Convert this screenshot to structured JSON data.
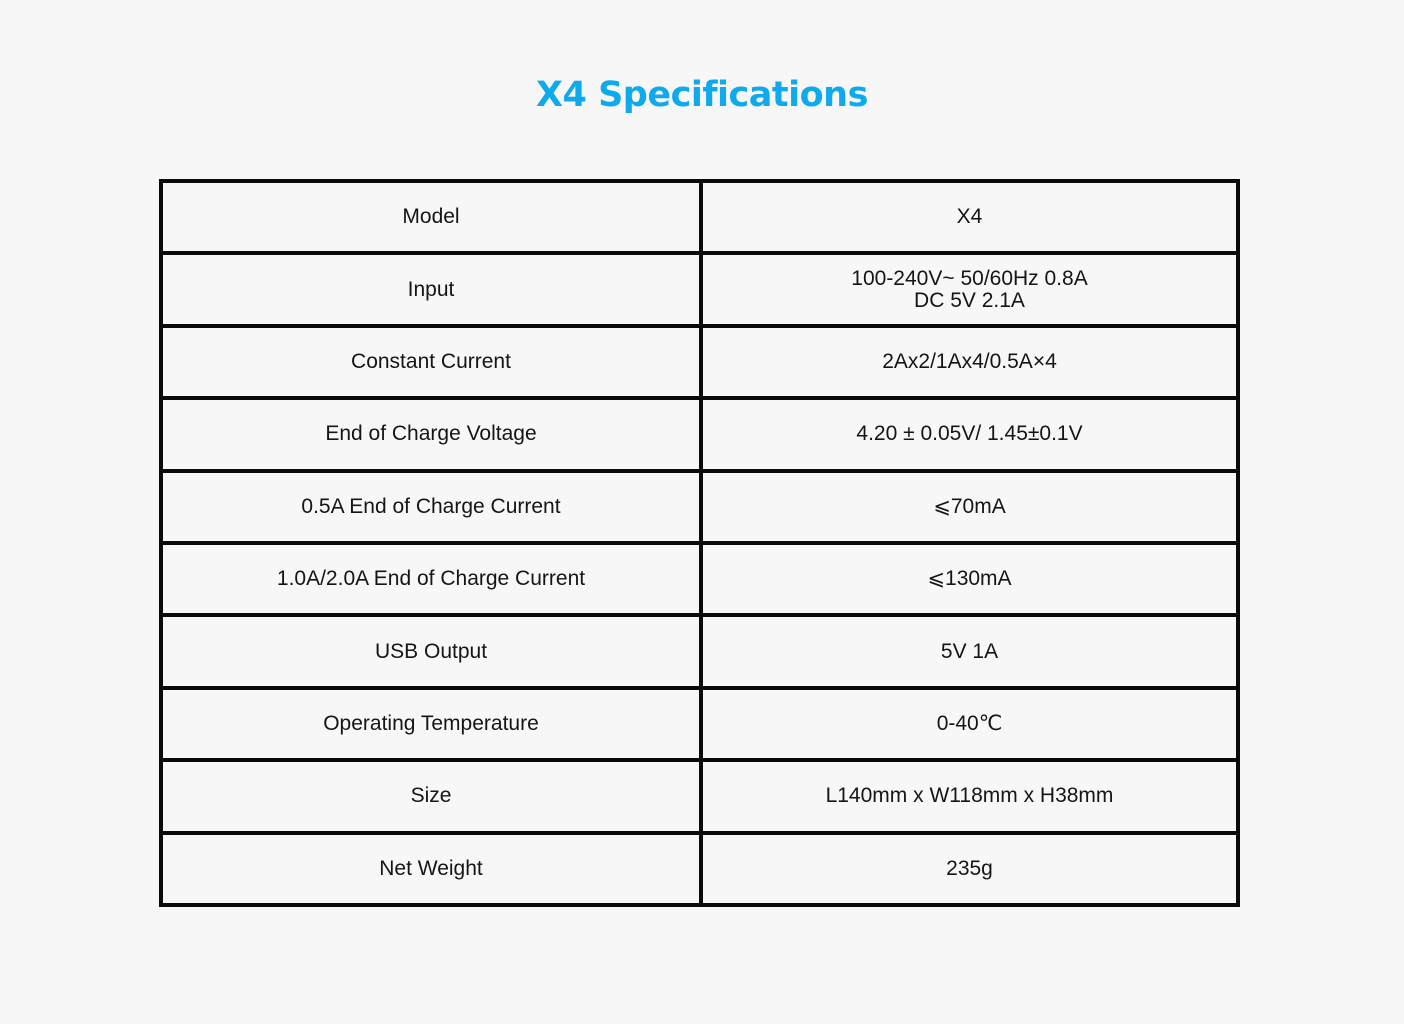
{
  "page": {
    "title": "X4 Specifications",
    "accent_color": "#0fa9ee"
  },
  "table": {
    "rows": [
      {
        "label": "Model",
        "value": [
          "X4"
        ]
      },
      {
        "label": "Input",
        "value": [
          "100-240V~ 50/60Hz 0.8A",
          "DC 5V 2.1A"
        ]
      },
      {
        "label": "Constant Current",
        "value": [
          "2Ax2/1Ax4/0.5A×4"
        ]
      },
      {
        "label": "End of Charge Voltage",
        "value": [
          "4.20 ± 0.05V/ 1.45±0.1V"
        ]
      },
      {
        "label": "0.5A End of Charge Current",
        "value": [
          "⩽70mA"
        ]
      },
      {
        "label": "1.0A/2.0A End of Charge Current",
        "value": [
          "⩽130mA"
        ]
      },
      {
        "label": "USB Output",
        "value": [
          "5V 1A"
        ]
      },
      {
        "label": "Operating Temperature",
        "value": [
          "0-40℃"
        ]
      },
      {
        "label": "Size",
        "value": [
          "L140mm x W118mm x H38mm"
        ]
      },
      {
        "label": "Net Weight",
        "value": [
          "235g"
        ]
      }
    ]
  }
}
